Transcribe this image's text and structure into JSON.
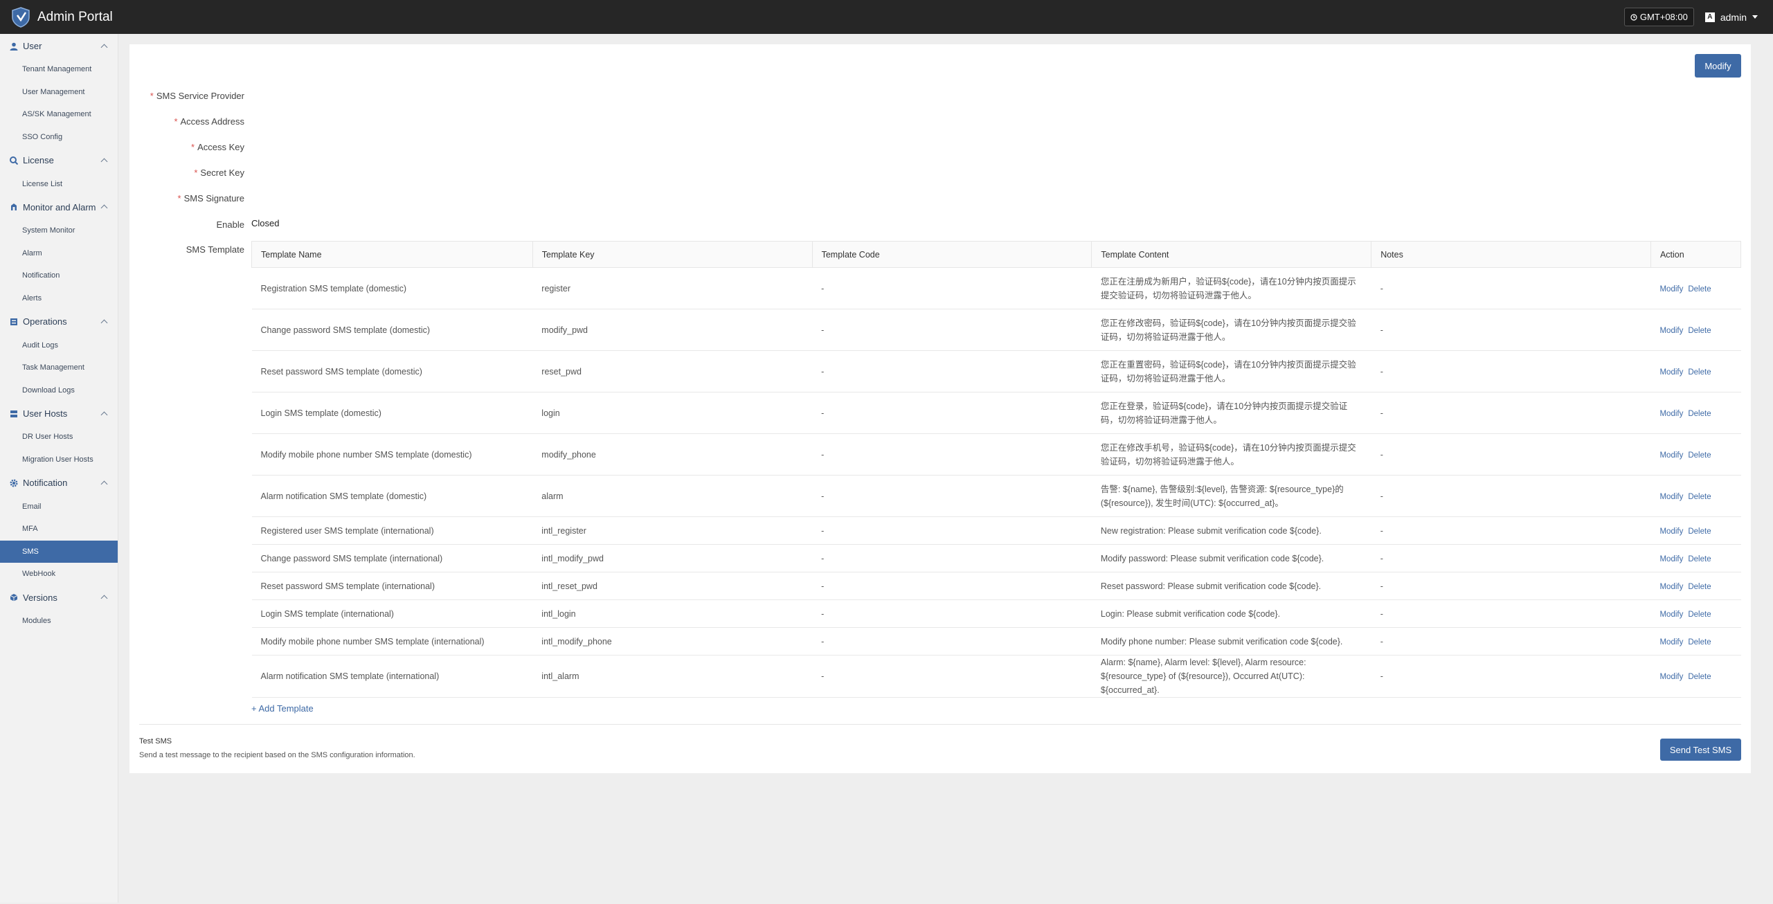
{
  "app": {
    "title": "Admin Portal"
  },
  "header": {
    "timezone": "GMT+08:00",
    "user": "admin"
  },
  "sidebar": {
    "groups": [
      {
        "label": "User",
        "icon": "user-icon",
        "items": [
          "Tenant Management",
          "User Management",
          "AS/SK Management",
          "SSO Config"
        ]
      },
      {
        "label": "License",
        "icon": "license-icon",
        "items": [
          "License List"
        ]
      },
      {
        "label": "Monitor and Alarm",
        "icon": "monitor-icon",
        "items": [
          "System Monitor",
          "Alarm",
          "Notification",
          "Alerts"
        ]
      },
      {
        "label": "Operations",
        "icon": "operations-icon",
        "items": [
          "Audit Logs",
          "Task Management",
          "Download Logs"
        ]
      },
      {
        "label": "User Hosts",
        "icon": "hosts-icon",
        "items": [
          "DR User Hosts",
          "Migration User Hosts"
        ]
      },
      {
        "label": "Notification",
        "icon": "gear-icon",
        "items": [
          "Email",
          "MFA",
          "SMS",
          "WebHook"
        ]
      },
      {
        "label": "Versions",
        "icon": "versions-icon",
        "items": [
          "Modules"
        ]
      }
    ],
    "active_item": "SMS"
  },
  "page": {
    "modify_label": "Modify",
    "form": {
      "sms_service_provider": "SMS Service Provider",
      "access_address": "Access Address",
      "access_key": "Access Key",
      "secret_key": "Secret Key",
      "sms_signature": "SMS Signature",
      "enable_label": "Enable",
      "enable_value": "Closed",
      "sms_template_label": "SMS Template",
      "required_mark": "*"
    },
    "table": {
      "columns": [
        "Template Name",
        "Template Key",
        "Template Code",
        "Template Content",
        "Notes",
        "Action"
      ],
      "rows": [
        {
          "name": "Registration SMS template (domestic)",
          "key": "register",
          "code": "-",
          "content": "您正在注册成为新用户，验证码${code}，请在10分钟内按页面提示提交验证码，切勿将验证码泄露于他人。",
          "notes": "-"
        },
        {
          "name": "Change password SMS template (domestic)",
          "key": "modify_pwd",
          "code": "-",
          "content": "您正在修改密码，验证码${code}，请在10分钟内按页面提示提交验证码，切勿将验证码泄露于他人。",
          "notes": "-"
        },
        {
          "name": "Reset password SMS template (domestic)",
          "key": "reset_pwd",
          "code": "-",
          "content": "您正在重置密码，验证码${code}，请在10分钟内按页面提示提交验证码，切勿将验证码泄露于他人。",
          "notes": "-"
        },
        {
          "name": "Login SMS template (domestic)",
          "key": "login",
          "code": "-",
          "content": "您正在登录，验证码${code}，请在10分钟内按页面提示提交验证码，切勿将验证码泄露于他人。",
          "notes": "-"
        },
        {
          "name": "Modify mobile phone number SMS template (domestic)",
          "key": "modify_phone",
          "code": "-",
          "content": "您正在修改手机号，验证码${code}，请在10分钟内按页面提示提交验证码，切勿将验证码泄露于他人。",
          "notes": "-"
        },
        {
          "name": "Alarm notification SMS template (domestic)",
          "key": "alarm",
          "code": "-",
          "content": "告警: ${name}, 告警级别:${level}, 告警资源: ${resource_type}的(${resource}), 发生时间(UTC): ${occurred_at}。",
          "notes": "-"
        },
        {
          "name": "Registered user SMS template (international)",
          "key": "intl_register",
          "code": "-",
          "content": "New registration: Please submit verification code ${code}.",
          "notes": "-"
        },
        {
          "name": "Change password SMS template (international)",
          "key": "intl_modify_pwd",
          "code": "-",
          "content": "Modify password: Please submit verification code ${code}.",
          "notes": "-"
        },
        {
          "name": "Reset password SMS template (international)",
          "key": "intl_reset_pwd",
          "code": "-",
          "content": "Reset password: Please submit verification code ${code}.",
          "notes": "-"
        },
        {
          "name": "Login SMS template (international)",
          "key": "intl_login",
          "code": "-",
          "content": "Login: Please submit verification code ${code}.",
          "notes": "-"
        },
        {
          "name": "Modify mobile phone number SMS template (international)",
          "key": "intl_modify_phone",
          "code": "-",
          "content": "Modify phone number: Please submit verification code ${code}.",
          "notes": "-"
        },
        {
          "name": "Alarm notification SMS template (international)",
          "key": "intl_alarm",
          "code": "-",
          "content": "Alarm: ${name}, Alarm level: ${level}, Alarm resource: ${resource_type} of (${resource}), Occurred At(UTC): ${occurred_at}.",
          "notes": "-"
        }
      ],
      "action_modify": "Modify",
      "action_delete": "Delete"
    },
    "add_template": "+ Add Template",
    "test_sms": {
      "title": "Test SMS",
      "description": "Send a test message to the recipient based on the SMS configuration information.",
      "button": "Send Test SMS"
    }
  },
  "colors": {
    "accent": "#3e6aa6",
    "topbar": "#262626",
    "sidebar_bg": "#f2f2f2",
    "required": "#d9534f"
  }
}
